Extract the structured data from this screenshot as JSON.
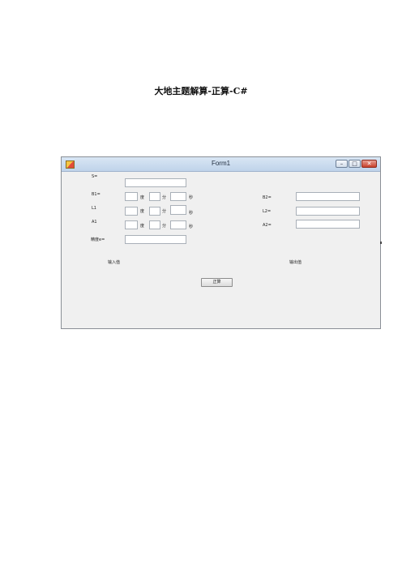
{
  "document": {
    "title": "大地主题解算-正算-C#"
  },
  "window": {
    "title": "Form1",
    "controls": {
      "minimize": "–",
      "maximize": "□",
      "close": "✕"
    }
  },
  "form": {
    "inputs": {
      "s_label": "S=",
      "b1_label": "B1=",
      "l1_label": "L1",
      "a1_label": "A1",
      "precision_label": "精度e=",
      "unit_degree": "度",
      "unit_minute": "分",
      "unit_second": "秒",
      "section_label": "输入值"
    },
    "outputs": {
      "b2_label": "B2=",
      "l2_label": "L2=",
      "a2_label": "A2=",
      "section_label": "输出值"
    },
    "compute_button": "正算"
  }
}
